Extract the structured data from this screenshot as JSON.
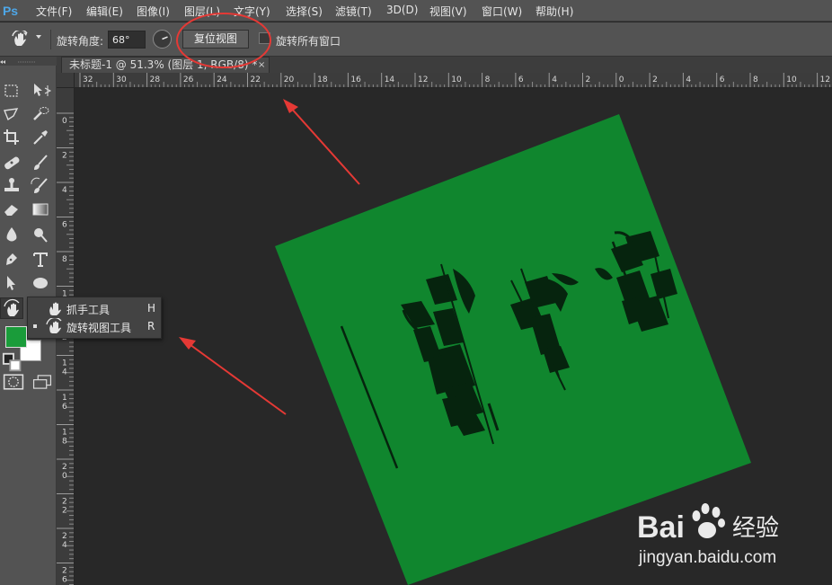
{
  "app": {
    "logo_text": "Ps"
  },
  "menu": {
    "items": [
      "文件(F)",
      "编辑(E)",
      "图像(I)",
      "图层(L)",
      "文字(Y)",
      "选择(S)",
      "滤镜(T)",
      "3D(D)",
      "视图(V)",
      "窗口(W)",
      "帮助(H)"
    ]
  },
  "options_bar": {
    "angle_label": "旋转角度:",
    "angle_value": "68°",
    "reset_view_label": "复位视图",
    "rotate_all_windows_label": "旋转所有窗口",
    "rotate_all_windows_checked": false
  },
  "document": {
    "tab_title": "未标题-1 @ 51.3% (图层 1, RGB/8) *",
    "tab_close": "×",
    "canvas_color": "#10862e",
    "glyph_color": "#06240e",
    "rotation_degrees": 68
  },
  "rulers": {
    "horizontal_ticks": [
      "32",
      "30",
      "28",
      "26",
      "24",
      "22",
      "20",
      "18",
      "16",
      "14",
      "12",
      "10",
      "8",
      "6",
      "4",
      "2",
      "0",
      "2",
      "4",
      "6",
      "8",
      "10",
      "12"
    ],
    "vertical_ticks": [
      "0",
      "2",
      "4",
      "6",
      "8",
      "10",
      "12",
      "14",
      "16",
      "18",
      "20",
      "22",
      "24",
      "26"
    ]
  },
  "toolbox": {
    "foreground_color": "#1a9c3a",
    "background_color": "#ffffff"
  },
  "flyout": {
    "items": [
      {
        "label": "抓手工具",
        "shortcut": "H",
        "active": false
      },
      {
        "label": "旋转视图工具",
        "shortcut": "R",
        "active": true
      }
    ]
  },
  "annotations": {
    "color": "#e53935"
  },
  "watermark": {
    "brand": "Bai",
    "brand_suffix": "经验",
    "url": "jingyan.baidu.com"
  }
}
